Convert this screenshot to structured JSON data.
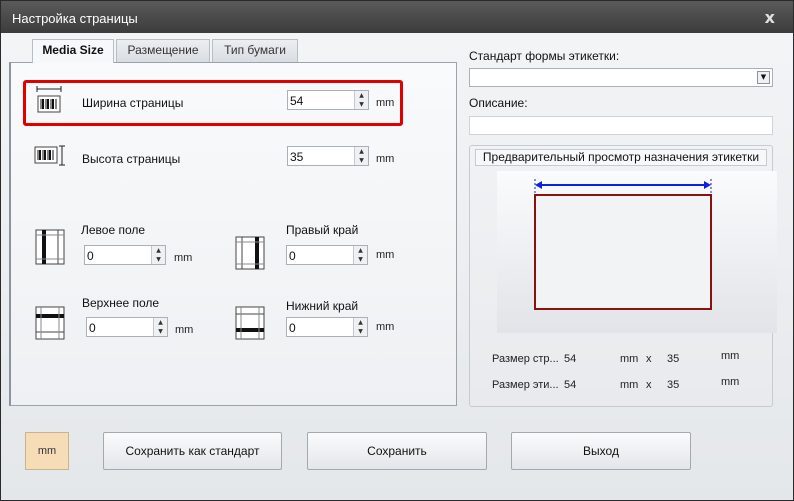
{
  "window": {
    "title": "Настройка страницы",
    "close_glyph": "x"
  },
  "tabs": [
    {
      "label": "Media Size",
      "active": true
    },
    {
      "label": "Размещение",
      "active": false
    },
    {
      "label": "Тип бумаги",
      "active": false
    }
  ],
  "media": {
    "page_width": {
      "label": "Ширина страницы",
      "value": "54",
      "unit": "mm",
      "icon": "page-width-icon"
    },
    "page_height": {
      "label": "Высота страницы",
      "value": "35",
      "unit": "mm",
      "icon": "page-height-icon"
    },
    "left_margin": {
      "label": "Левое поле",
      "value": "0",
      "unit": "mm",
      "icon": "left-margin-icon"
    },
    "right_edge": {
      "label": "Правый край",
      "value": "0",
      "unit": "mm",
      "icon": "right-margin-icon"
    },
    "top_margin": {
      "label": "Верхнее поле",
      "value": "0",
      "unit": "mm",
      "icon": "top-margin-icon"
    },
    "bottom_edge": {
      "label": "Нижний край",
      "value": "0",
      "unit": "mm",
      "icon": "bottom-margin-icon"
    }
  },
  "label_standard": {
    "label": "Стандарт формы этикетки:",
    "value": ""
  },
  "description": {
    "label": "Описание:",
    "value": ""
  },
  "preview": {
    "title": "Предварительный просмотр назначения этикетки",
    "page_size": {
      "label": "Размер стр...",
      "width": "54",
      "unit1": "mm",
      "x": "x",
      "height": "35",
      "unit2": "mm"
    },
    "label_size": {
      "label": "Размер эти...",
      "width": "54",
      "unit1": "mm",
      "x": "x",
      "height": "35",
      "unit2": "mm"
    }
  },
  "buttons": {
    "units": "mm",
    "save_as_default": "Сохранить как стандарт",
    "save": "Сохранить",
    "exit": "Выход"
  },
  "colors": {
    "highlight": "#e00000",
    "preview_border": "#8b1010",
    "arrow": "#1020e0",
    "units_button": "#f6ddb8"
  }
}
